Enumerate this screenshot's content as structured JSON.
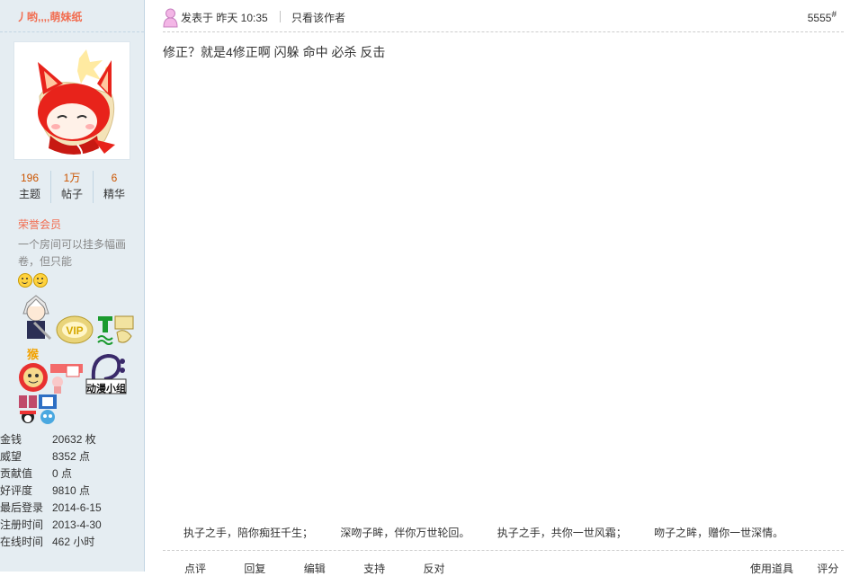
{
  "user": {
    "name": "丿哟,,,,萌妹纸",
    "stats": [
      {
        "value": "196",
        "label": "主题"
      },
      {
        "value": "1万",
        "label": "帖子"
      },
      {
        "value": "6",
        "label": "精华"
      }
    ],
    "rank": "荣誉会员",
    "signature": "一个房间可以挂多幅画卷，但只能",
    "medal_text": "猴",
    "medal_badge_text": "动漫小组",
    "info": [
      {
        "key": "金钱",
        "value": "20632 枚"
      },
      {
        "key": "威望",
        "value": "8352 点"
      },
      {
        "key": "贡献值",
        "value": "0 点"
      },
      {
        "key": "好评度",
        "value": "9810 点"
      },
      {
        "key": "最后登录",
        "value": "2014-6-15"
      },
      {
        "key": "注册时间",
        "value": "2013-4-30"
      },
      {
        "key": "在线时间",
        "value": "462 小时"
      }
    ]
  },
  "post": {
    "time": "发表于 昨天 10:35",
    "author_only": "只看该作者",
    "floor": "5555",
    "floor_mark": "#",
    "content": "修正？就是4修正啊   闪躲 命中 必杀 反击",
    "signature_lines": [
      "执子之手，陪你痴狂千生；",
      "深吻子眸，伴你万世轮回。",
      "执子之手，共你一世风霜；",
      "吻子之眸，赠你一世深情。"
    ],
    "actions": [
      "点评",
      "回复",
      "编辑",
      "支持",
      "反对"
    ],
    "tools": [
      "使用道具",
      "评分"
    ]
  },
  "colors": {
    "sidebar_bg": "#e5edf2",
    "username": "#f26c4f",
    "stat_value": "#cc5500",
    "rank": "#f26c4f"
  }
}
